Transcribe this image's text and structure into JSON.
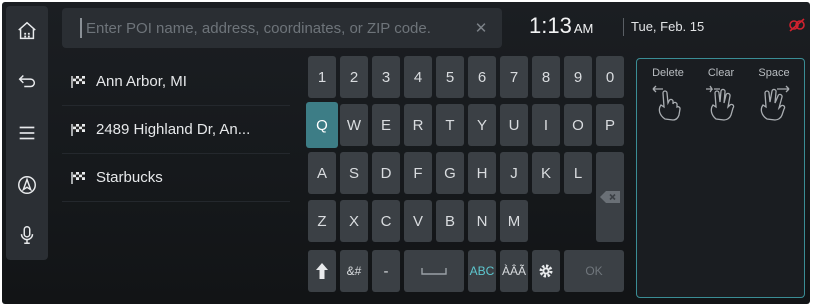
{
  "sidebar": {
    "items": [
      {
        "name": "home",
        "icon": "home-icon"
      },
      {
        "name": "back",
        "icon": "back-arrow-icon"
      },
      {
        "name": "menu",
        "icon": "menu-icon"
      },
      {
        "name": "navigation",
        "icon": "navigation-icon"
      },
      {
        "name": "voice",
        "icon": "microphone-icon"
      }
    ]
  },
  "search": {
    "placeholder": "Enter POI name, address, coordinates, or ZIP code.",
    "value": "",
    "clear_icon": "close-icon"
  },
  "status": {
    "time": "1:13",
    "ampm": "AM",
    "date": "Tue, Feb. 15",
    "status_icon": "connection-off-icon",
    "status_color": "#d0222f"
  },
  "results": [
    {
      "label": "Ann Arbor, MI",
      "icon": "checkered-flag-icon"
    },
    {
      "label": "2489 Highland Dr, An...",
      "icon": "checkered-flag-icon"
    },
    {
      "label": "Starbucks",
      "icon": "checkered-flag-icon"
    }
  ],
  "keyboard": {
    "row1": [
      "1",
      "2",
      "3",
      "4",
      "5",
      "6",
      "7",
      "8",
      "9",
      "0"
    ],
    "row2": [
      "Q",
      "W",
      "E",
      "R",
      "T",
      "Y",
      "U",
      "I",
      "O",
      "P"
    ],
    "row3": [
      "A",
      "S",
      "D",
      "F",
      "G",
      "H",
      "J",
      "K",
      "L"
    ],
    "row4": [
      "Z",
      "X",
      "C",
      "V",
      "B",
      "N",
      "M"
    ],
    "active_key": "Q",
    "backspace_icon": "backspace-icon",
    "shift_icon": "shift-arrow-icon",
    "symbols_label": "&#",
    "dash_label": "-",
    "space_icon": "spacebar-icon",
    "abc_label": "ABC",
    "accents_label": "ÀÂÃ",
    "settings_icon": "gear-icon",
    "ok_label": "OK"
  },
  "gestures": {
    "delete_label": "Delete",
    "clear_label": "Clear",
    "space_label": "Space",
    "icons": [
      "swipe-left-hand-icon",
      "scrub-hand-icon",
      "swipe-right-hand-icon"
    ]
  },
  "colors": {
    "accent": "#3d7d86",
    "accent_text": "#5dc7cf",
    "panel_border": "#3a8d95"
  }
}
